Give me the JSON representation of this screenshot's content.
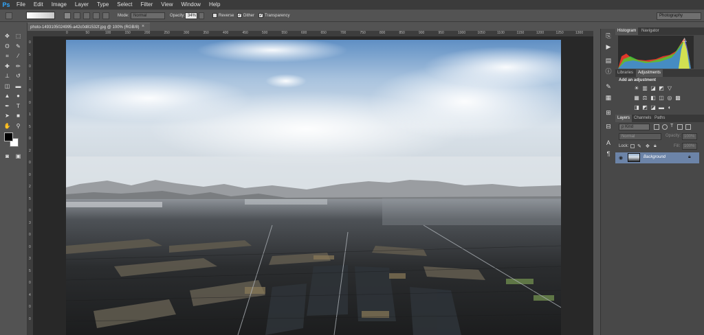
{
  "app": {
    "logo": "Ps"
  },
  "menu": [
    "File",
    "Edit",
    "Image",
    "Layer",
    "Type",
    "Select",
    "Filter",
    "View",
    "Window",
    "Help"
  ],
  "options": {
    "mode_label": "Mode:",
    "mode_value": "Normal",
    "opacity_label": "Opacity:",
    "opacity_value": "34%",
    "reverse_label": "Reverse",
    "dither_label": "Dither",
    "transparency_label": "Transparency",
    "workspace": "Photography"
  },
  "document": {
    "tab_title": "photo-1493105024995-a42c0d81532f.jpg @ 100% (RGB/8)",
    "close": "×"
  },
  "rulers": {
    "top": [
      "0",
      "50",
      "100",
      "150",
      "200",
      "250",
      "300",
      "350",
      "400",
      "450",
      "500",
      "550",
      "600",
      "650",
      "700",
      "750",
      "800",
      "850",
      "900",
      "950",
      "1000",
      "1050",
      "1100",
      "1150",
      "1200",
      "1250",
      "1300",
      "1350",
      "1400"
    ],
    "left": [
      "0",
      "5",
      "0",
      "1",
      "0",
      "0",
      "1",
      "5",
      "0",
      "2",
      "0",
      "0",
      "2",
      "5",
      "0",
      "3",
      "0",
      "0",
      "3",
      "5",
      "0",
      "4",
      "0",
      "0"
    ]
  },
  "panels": {
    "histogram_tabs": [
      "Histogram",
      "Navigator"
    ],
    "adjust_tabs": [
      "Libraries",
      "Adjustments"
    ],
    "adjust_title": "Add an adjustment",
    "layers_tabs": [
      "Layers",
      "Channels",
      "Paths"
    ],
    "kind_label": "ρ Kind",
    "blend_mode": "Normal",
    "opacity_label": "Opacity:",
    "opacity_value": "100%",
    "lock_label": "Lock:",
    "fill_label": "Fill:",
    "fill_value": "100%",
    "layer_name": "Background"
  },
  "colors": {
    "accent": "#31a8ff",
    "panel_bg": "#484848",
    "selected_layer": "#6c84a8"
  },
  "icons": {
    "tools": [
      "move-icon",
      "marquee-icon",
      "lasso-icon",
      "quick-select-icon",
      "crop-icon",
      "eyedropper-icon",
      "healing-icon",
      "brush-icon",
      "stamp-icon",
      "history-brush-icon",
      "eraser-icon",
      "gradient-icon",
      "blur-icon",
      "dodge-icon",
      "pen-icon",
      "type-icon",
      "path-select-icon",
      "shape-icon",
      "hand-icon",
      "zoom-icon"
    ]
  }
}
